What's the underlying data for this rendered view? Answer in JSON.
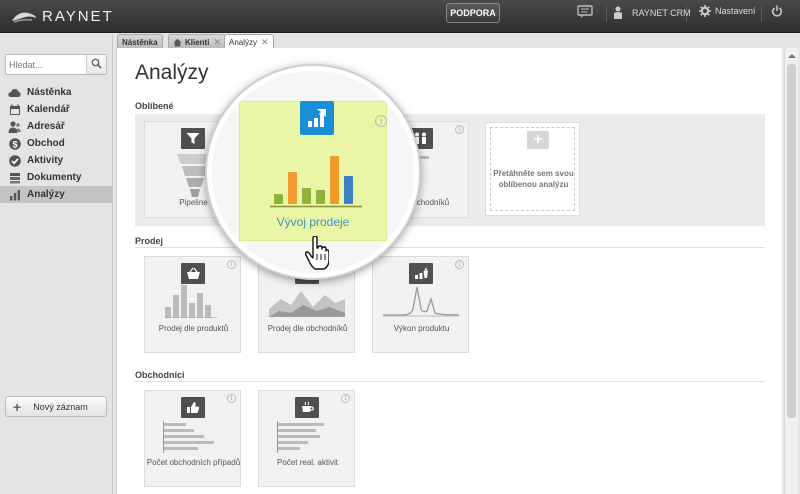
{
  "app": {
    "logo_text": "RAYNET"
  },
  "topbar": {
    "support_label": "PODPORA",
    "user_label": "RAYNET CRM",
    "settings_label": "Nastavení"
  },
  "sidebar": {
    "search_placeholder": "Hledat...",
    "items": [
      {
        "label": "Nástěnka",
        "icon": "cloud-icon"
      },
      {
        "label": "Kalendář",
        "icon": "calendar-icon"
      },
      {
        "label": "Adresář",
        "icon": "people-icon"
      },
      {
        "label": "Obchod",
        "icon": "dollar-icon"
      },
      {
        "label": "Aktivity",
        "icon": "check-circle-icon"
      },
      {
        "label": "Dokumenty",
        "icon": "documents-icon"
      },
      {
        "label": "Analýzy",
        "icon": "bar-chart-icon",
        "active": true
      }
    ],
    "new_record_label": "Nový záznam"
  },
  "tabs": [
    {
      "label": "Nástěnka",
      "closable": false
    },
    {
      "label": "Klienti",
      "closable": true
    },
    {
      "label": "Analýzy",
      "closable": true,
      "active": true
    }
  ],
  "main": {
    "title": "Analýzy",
    "sections": {
      "favorites": {
        "label": "Oblíbené",
        "cards": [
          {
            "label": "Pipeline",
            "icon": "funnel-icon"
          },
          {
            "label": "Vývoj prodeje",
            "icon": "growth-chart-icon"
          },
          {
            "label": "obchodníků",
            "icon": "people-icon"
          }
        ],
        "drop_text": "Přetáhněte sem svou oblíbenou analýzu"
      },
      "sales": {
        "label": "Prodej",
        "cards": [
          {
            "label": "Prodej dle produktů",
            "icon": "basket-icon"
          },
          {
            "label": "Prodej dle obchodníků",
            "icon": "basket-icon"
          },
          {
            "label": "Výkon produktu",
            "icon": "product-performance-icon"
          }
        ]
      },
      "traders": {
        "label": "Obchodníci",
        "cards": [
          {
            "label": "Počet obchodních případů",
            "icon": "thumbs-up-icon"
          },
          {
            "label": "Počet real. aktivit",
            "icon": "coffee-icon"
          }
        ]
      }
    },
    "magnified_card": {
      "label": "Vývoj prodeje",
      "bar_colors": [
        "#8fb23a",
        "#f39a2c",
        "#8fb23a",
        "#8fb23a",
        "#f39a2c",
        "#3b7fc4"
      ]
    }
  },
  "colors": {
    "accent": "#1b8fd6",
    "highlight": "#eaf6a6",
    "link": "#3e8fc4"
  }
}
